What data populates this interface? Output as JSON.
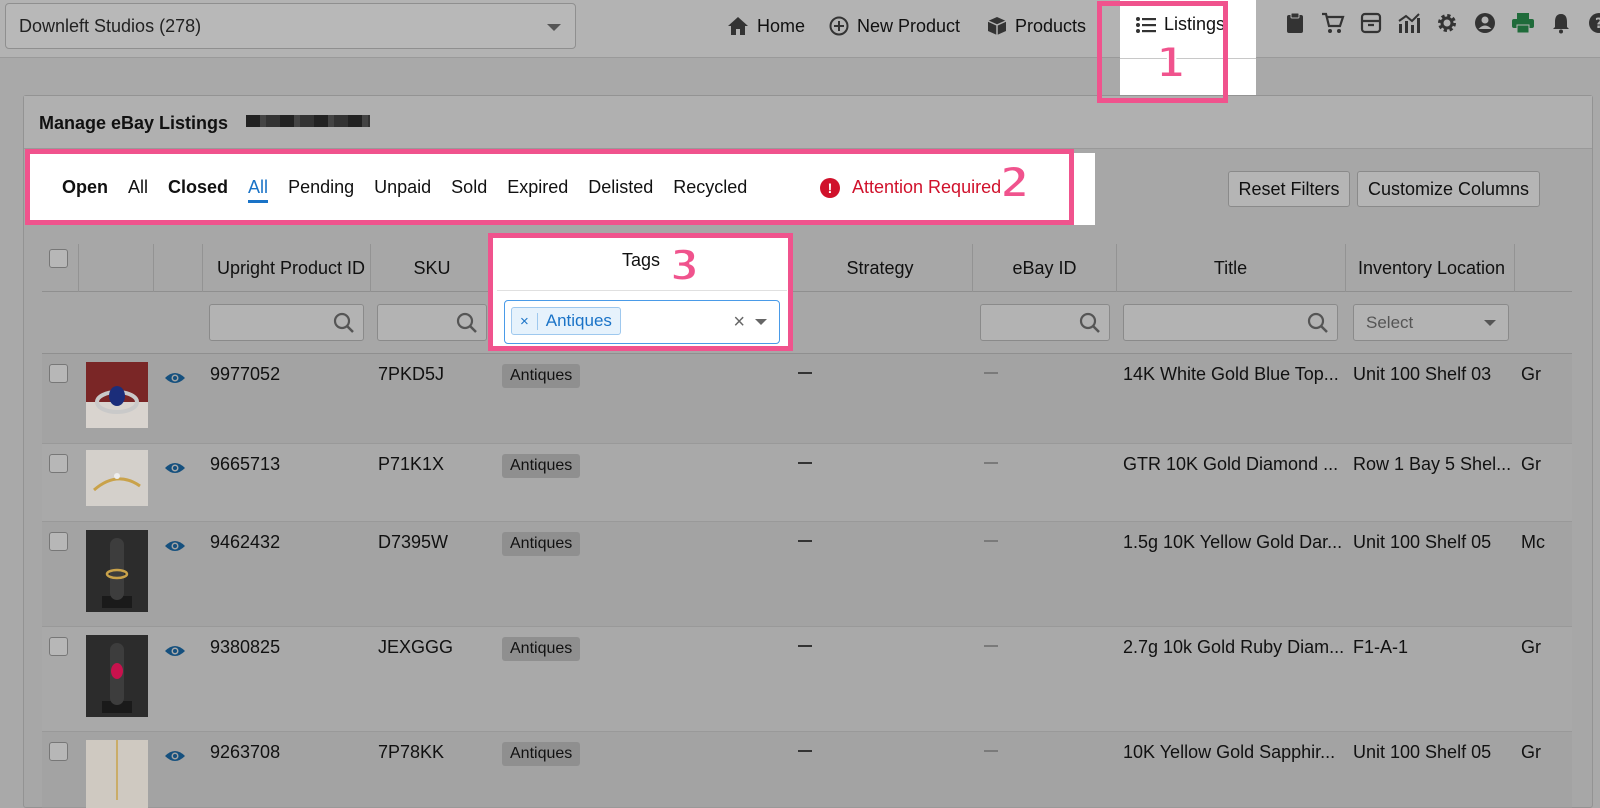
{
  "header": {
    "store_select": "Downleft Studios (278)",
    "nav": {
      "home": "Home",
      "new_product": "New Product",
      "products": "Products",
      "listings": "Listings"
    },
    "tool_icons": [
      "clipboard-icon",
      "cart-icon",
      "archive-icon",
      "chart-icon",
      "gear-icon",
      "user-circle-icon",
      "printer-icon",
      "bell-icon",
      "help-icon"
    ]
  },
  "page": {
    "title": "Manage eBay Listings",
    "filters": {
      "open": "Open",
      "open_all": "All",
      "closed": "Closed",
      "closed_all": "All",
      "pending": "Pending",
      "unpaid": "Unpaid",
      "sold": "Sold",
      "expired": "Expired",
      "delisted": "Delisted",
      "recycled": "Recycled",
      "attention": "Attention Required"
    },
    "buttons": {
      "reset": "Reset Filters",
      "customize": "Customize Columns"
    }
  },
  "table": {
    "headers": {
      "product_id": "Upright Product ID",
      "sku": "SKU",
      "tags": "Tags",
      "strategy": "Strategy",
      "ebay_id": "eBay ID",
      "title": "Title",
      "inventory": "Inventory Location"
    },
    "tag_filter_value": "Antiques",
    "select_placeholder": "Select",
    "rows": [
      {
        "id": "9977052",
        "sku": "7PKD5J",
        "tag": "Antiques",
        "title": "14K White Gold Blue Top...",
        "location": "Unit 100 Shelf 03",
        "extra": "Gr"
      },
      {
        "id": "9665713",
        "sku": "P71K1X",
        "tag": "Antiques",
        "title": "GTR 10K Gold Diamond ...",
        "location": "Row 1 Bay 5 Shel...",
        "extra": "Gr"
      },
      {
        "id": "9462432",
        "sku": "D7395W",
        "tag": "Antiques",
        "title": "1.5g 10K Yellow Gold Dar...",
        "location": "Unit 100 Shelf 05",
        "extra": "Mc"
      },
      {
        "id": "9380825",
        "sku": "JEXGGG",
        "tag": "Antiques",
        "title": "2.7g 10k Gold Ruby Diam...",
        "location": "F1-A-1",
        "extra": "Gr"
      },
      {
        "id": "9263708",
        "sku": "7P78KK",
        "tag": "Antiques",
        "title": "10K Yellow Gold Sapphir...",
        "location": "Unit 100 Shelf 05",
        "extra": "Gr"
      }
    ]
  },
  "annotations": {
    "one": "1",
    "two": "2",
    "three": "3"
  },
  "colors": {
    "accent": "#1a73c7",
    "highlight": "#f0538d",
    "alert": "#d0112b"
  }
}
